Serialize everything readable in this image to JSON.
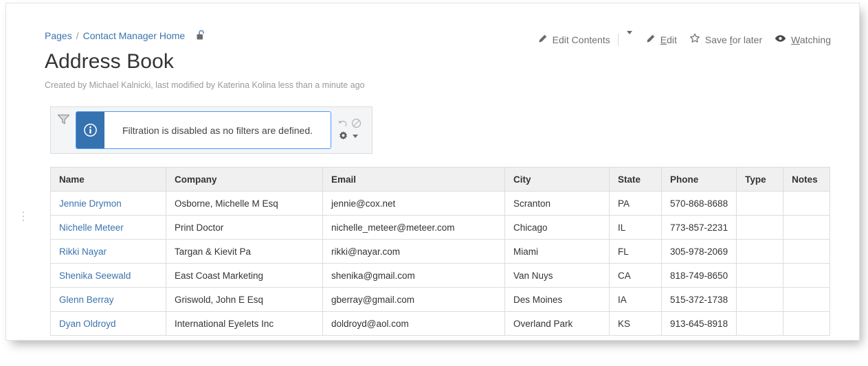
{
  "breadcrumb": {
    "items": [
      {
        "label": "Pages",
        "link": true
      },
      {
        "label": "Contact Manager Home",
        "link": true
      }
    ],
    "separator": "/",
    "restriction_icon": "unlocked-padlock-icon"
  },
  "page": {
    "title": "Address Book",
    "byline": "Created by Michael Kalnicki, last modified by Katerina Kolina less than a minute ago"
  },
  "toolbar": {
    "edit_contents": {
      "label": "Edit Contents",
      "icon": "pencil-icon"
    },
    "dropdown_caret": {
      "icon": "chevron-down-icon"
    },
    "edit": {
      "label": "Edit",
      "accesskey": "E",
      "icon": "pencil-icon"
    },
    "save_for_later": {
      "label_before": "Save ",
      "accesskey": "f",
      "label_after": "or later",
      "icon": "star-icon"
    },
    "watching": {
      "accesskey": "W",
      "label_after": "atching",
      "icon": "eye-icon"
    }
  },
  "filter_panel": {
    "funnel_icon": "funnel-icon",
    "info_icon": "info-circle-icon",
    "message": "Filtration is disabled as no filters are defined.",
    "actions": {
      "undo": "undo-arrow-icon",
      "clear": "no-entry-icon",
      "settings": "gear-icon",
      "settings_caret": "chevron-down-icon"
    }
  },
  "table": {
    "columns": [
      "Name",
      "Company",
      "Email",
      "City",
      "State",
      "Phone",
      "Type",
      "Notes"
    ],
    "rows": [
      {
        "name": "Jennie Drymon",
        "company": "Osborne, Michelle M Esq",
        "email": "jennie@cox.net",
        "city": "Scranton",
        "state": "PA",
        "phone": "570-868-8688",
        "type": "",
        "notes": ""
      },
      {
        "name": "Nichelle Meteer",
        "company": "Print Doctor",
        "email": "nichelle_meteer@meteer.com",
        "city": "Chicago",
        "state": "IL",
        "phone": "773-857-2231",
        "type": "",
        "notes": ""
      },
      {
        "name": "Rikki Nayar",
        "company": "Targan & Kievit Pa",
        "email": "rikki@nayar.com",
        "city": "Miami",
        "state": "FL",
        "phone": "305-978-2069",
        "type": "",
        "notes": ""
      },
      {
        "name": "Shenika Seewald",
        "company": "East Coast Marketing",
        "email": "shenika@gmail.com",
        "city": "Van Nuys",
        "state": "CA",
        "phone": "818-749-8650",
        "type": "",
        "notes": ""
      },
      {
        "name": "Glenn Berray",
        "company": "Griswold, John E Esq",
        "email": "gberray@gmail.com",
        "city": "Des Moines",
        "state": "IA",
        "phone": "515-372-1738",
        "type": "",
        "notes": ""
      },
      {
        "name": "Dyan Oldroyd",
        "company": "International Eyelets Inc",
        "email": "doldroyd@aol.com",
        "city": "Overland Park",
        "state": "KS",
        "phone": "913-645-8918",
        "type": "",
        "notes": ""
      }
    ]
  },
  "colors": {
    "link": "#3b73af",
    "info_badge": "#3572b0",
    "message_border": "#4c9aff",
    "panel_bg": "#f4f5f7",
    "header_bg": "#f0f0f0",
    "text": "#333333",
    "muted": "#999999"
  }
}
